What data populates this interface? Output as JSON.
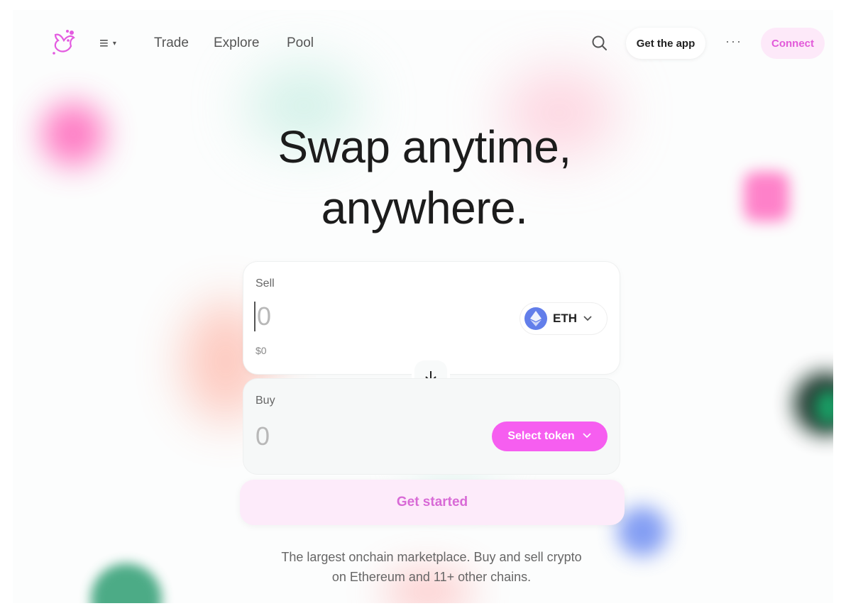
{
  "nav": {
    "links": {
      "trade": "Trade",
      "explore": "Explore",
      "pool": "Pool"
    },
    "get_app": "Get the app",
    "more": "···",
    "connect": "Connect",
    "menu_icon": "≡",
    "menu_caret": "▾"
  },
  "hero": {
    "line1": "Swap anytime,",
    "line2": "anywhere."
  },
  "swap": {
    "sell_label": "Sell",
    "sell_amount": "0",
    "sell_usd": "$0",
    "sell_token": "ETH",
    "buy_label": "Buy",
    "buy_amount": "0",
    "buy_token_button": "Select token",
    "cta": "Get started"
  },
  "tagline": {
    "line1": "The largest onchain marketplace. Buy and sell crypto",
    "line2": "on Ethereum and 11+ other chains."
  },
  "colors": {
    "accent": "#f65ef0",
    "connect_bg": "#fde9f9",
    "connect_text": "#e25ad9",
    "eth_blue": "#627eea"
  },
  "icons": [
    "uniswap-logo-icon",
    "menu-icon",
    "search-icon",
    "more-dots-icon",
    "eth-logo-icon",
    "chevron-down-icon",
    "arrow-down-icon"
  ]
}
